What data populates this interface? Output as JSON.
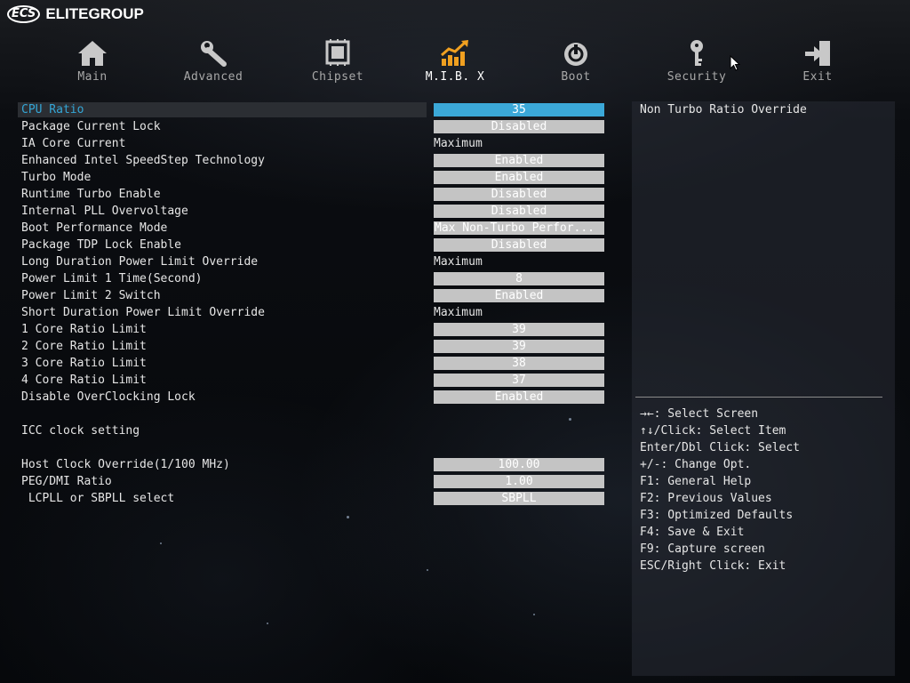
{
  "brand": {
    "mark": "ECS",
    "name": "ELITEGROUP"
  },
  "tabs": [
    {
      "label": "Main",
      "icon": "home-icon"
    },
    {
      "label": "Advanced",
      "icon": "wrench-icon"
    },
    {
      "label": "Chipset",
      "icon": "chip-icon"
    },
    {
      "label": "M.I.B. X",
      "icon": "chart-icon",
      "active": true
    },
    {
      "label": "Boot",
      "icon": "power-icon"
    },
    {
      "label": "Security",
      "icon": "key-icon"
    },
    {
      "label": "Exit",
      "icon": "exit-icon"
    }
  ],
  "settings": [
    {
      "label": "CPU Ratio",
      "value": "35",
      "style": "box",
      "selected": true
    },
    {
      "label": "Package Current Lock",
      "value": "Disabled",
      "style": "box"
    },
    {
      "label": "IA Core Current",
      "value": "Maximum",
      "style": "text"
    },
    {
      "label": "Enhanced Intel SpeedStep Technology",
      "value": "Enabled",
      "style": "box"
    },
    {
      "label": "Turbo Mode",
      "value": "Enabled",
      "style": "box"
    },
    {
      "label": "Runtime Turbo Enable",
      "value": "Disabled",
      "style": "box"
    },
    {
      "label": "Internal PLL Overvoltage",
      "value": "Disabled",
      "style": "box"
    },
    {
      "label": "Boot Performance Mode",
      "value": "Max Non-Turbo Perfor...",
      "style": "box-left"
    },
    {
      "label": "Package TDP Lock Enable",
      "value": "Disabled",
      "style": "box"
    },
    {
      "label": "Long Duration Power Limit Override",
      "value": "Maximum",
      "style": "text"
    },
    {
      "label": "Power Limit 1 Time(Second)",
      "value": "8",
      "style": "box"
    },
    {
      "label": "Power Limit 2 Switch",
      "value": "Enabled",
      "style": "box"
    },
    {
      "label": "Short Duration Power Limit Override",
      "value": "Maximum",
      "style": "text"
    },
    {
      "label": "1 Core Ratio Limit",
      "value": "39",
      "style": "box"
    },
    {
      "label": "2 Core Ratio Limit",
      "value": "39",
      "style": "box"
    },
    {
      "label": "3 Core Ratio Limit",
      "value": "38",
      "style": "box"
    },
    {
      "label": "4 Core Ratio Limit",
      "value": "37",
      "style": "box"
    },
    {
      "label": "Disable OverClocking Lock",
      "value": "Enabled",
      "style": "box"
    },
    {
      "label": "",
      "value": "",
      "style": "none"
    },
    {
      "label": "ICC clock setting",
      "value": "",
      "style": "none"
    },
    {
      "label": "",
      "value": "",
      "style": "none"
    },
    {
      "label": "Host Clock Override(1/100 MHz)",
      "value": "100.00",
      "style": "box"
    },
    {
      "label": "PEG/DMI Ratio",
      "value": "1.00",
      "style": "box"
    },
    {
      "label": " LCPLL or SBPLL select",
      "value": "SBPLL",
      "style": "box"
    }
  ],
  "help": {
    "title": "Non Turbo Ratio Override",
    "keys": [
      "→←: Select Screen",
      "↑↓/Click: Select Item",
      "Enter/Dbl Click: Select",
      "+/-: Change Opt.",
      "F1: General Help",
      "F2: Previous Values",
      "F3: Optimized Defaults",
      "F4: Save & Exit",
      "F9: Capture screen",
      "ESC/Right Click: Exit"
    ]
  },
  "colors": {
    "accent": "#3ba8d8",
    "selected_label": "#34a6d6",
    "value_box": "#c4c4c4",
    "active_tab_icon": "#f0a020",
    "inactive_tab_icon": "#c8c8c8"
  }
}
